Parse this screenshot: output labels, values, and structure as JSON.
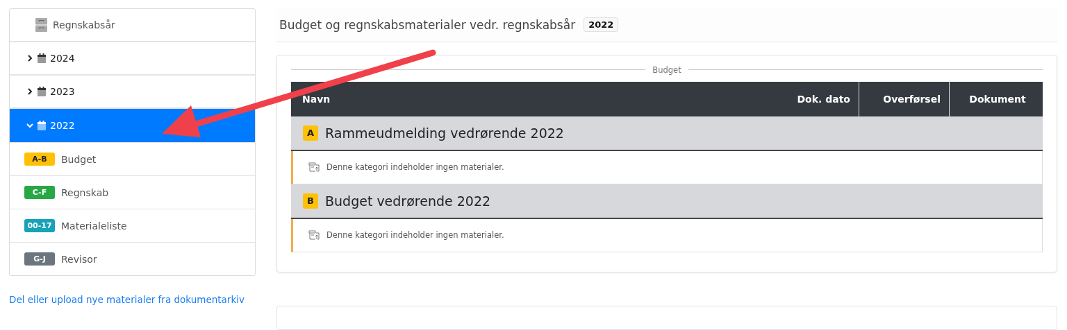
{
  "sidebar": {
    "title": "Regnskabsår",
    "years": [
      {
        "label": "2024",
        "expanded": false,
        "selected": false
      },
      {
        "label": "2023",
        "expanded": false,
        "selected": false
      },
      {
        "label": "2022",
        "expanded": true,
        "selected": true,
        "children": [
          {
            "badge": "A-B",
            "label": "Budget",
            "color": "#ffc107"
          },
          {
            "badge": "C-F",
            "label": "Regnskab",
            "color": "#28a745"
          },
          {
            "badge": "00-17",
            "label": "Materialeliste",
            "color": "#17a2b8"
          },
          {
            "badge": "G-J",
            "label": "Revisor",
            "color": "#6c757d"
          }
        ]
      }
    ]
  },
  "upload_link": "Del eller upload nye materialer fra dokumentarkiv",
  "heading": {
    "title": "Budget og regnskabsmaterialer vedr. regnskabsår",
    "year": "2022"
  },
  "section": {
    "legend": "Budget",
    "columns": [
      "Navn",
      "Dok. dato",
      "Overførsel",
      "Dokument"
    ],
    "categories": [
      {
        "letter": "A",
        "title": "Rammeudmelding vedrørende 2022",
        "empty_text": "Denne kategori indeholder ingen materialer."
      },
      {
        "letter": "B",
        "title": "Budget vedrørende 2022",
        "empty_text": "Denne kategori indeholder ingen materialer."
      }
    ]
  }
}
